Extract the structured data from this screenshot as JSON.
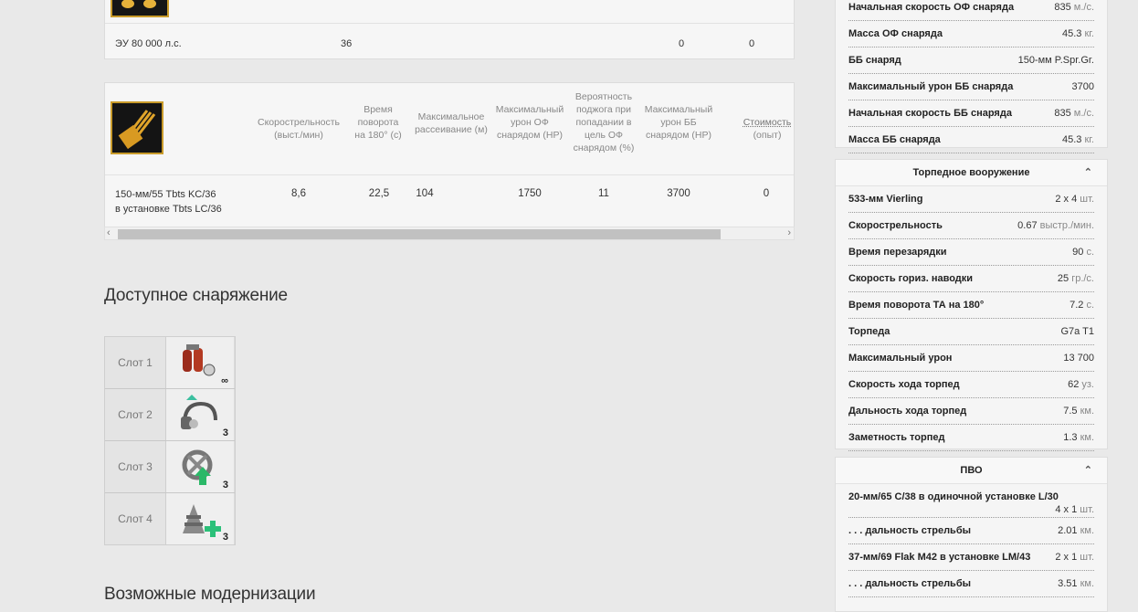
{
  "engine": {
    "name": "ЭУ 80 000 л.с.",
    "speed": "36",
    "c1": "0",
    "c2": "0"
  },
  "guns": {
    "headers": [
      "Скорострельность (выст./мин)",
      "Время поворота на 180° (с)",
      "Максимальное рассеивание (м)",
      "Максимальный урон ОФ снарядом (HP)",
      "Вероятность поджога при попадании в цель ОФ снарядом (%)",
      "Максимальный урон ББ снарядом (HP)",
      "Стоимость",
      "(опыт)"
    ],
    "row": {
      "name_line1": "150-мм/55 Tbts KC/36",
      "name_line2": "в установке Tbts LC/36",
      "values": [
        "8,6",
        "22,5",
        "104",
        "1750",
        "11",
        "3700",
        "0"
      ]
    }
  },
  "equipment": {
    "title": "Доступное снаряжение",
    "slots": [
      {
        "label": "Слот 1",
        "count": "∞",
        "icon": "damage-control-icon"
      },
      {
        "label": "Слот 2",
        "count": "3",
        "icon": "hydroacoustic-search-icon"
      },
      {
        "label": "Слот 3",
        "count": "3",
        "icon": "engine-boost-icon"
      },
      {
        "label": "Слот 4",
        "count": "3",
        "icon": "repair-party-icon"
      }
    ]
  },
  "upgrades": {
    "title": "Возможные модернизации"
  },
  "sidebar": {
    "main_battery_tail": [
      {
        "k": "Начальная скорость ОФ снаряда",
        "v": "835",
        "u": "м./с."
      },
      {
        "k": "Масса ОФ снаряда",
        "v": "45.3",
        "u": "кг."
      },
      {
        "k": "ББ снаряд",
        "v": "150-мм P.Spr.Gr.",
        "u": ""
      },
      {
        "k": "Максимальный урон ББ снаряда",
        "v": "3700",
        "u": ""
      },
      {
        "k": "Начальная скорость ББ снаряда",
        "v": "835",
        "u": "м./с."
      },
      {
        "k": "Масса ББ снаряда",
        "v": "45.3",
        "u": "кг."
      }
    ],
    "torpedo": {
      "title": "Торпедное вооружение",
      "rows": [
        {
          "k": "533-мм Vierling",
          "v": "2 x 4",
          "u": "шт."
        },
        {
          "k": "Скорострельность",
          "v": "0.67",
          "u": "выстр./мин."
        },
        {
          "k": "Время перезарядки",
          "v": "90",
          "u": "с."
        },
        {
          "k": "Скорость гориз. наводки",
          "v": "25",
          "u": "гр./с."
        },
        {
          "k": "Время поворота ТА на 180°",
          "v": "7.2",
          "u": "с."
        },
        {
          "k": "Торпеда",
          "v": "G7a T1",
          "u": ""
        },
        {
          "k": "Максимальный урон",
          "v": "13 700",
          "u": ""
        },
        {
          "k": "Скорость хода торпед",
          "v": "62",
          "u": "уз."
        },
        {
          "k": "Дальность хода торпед",
          "v": "7.5",
          "u": "км."
        },
        {
          "k": "Заметность торпед",
          "v": "1.3",
          "u": "км."
        }
      ]
    },
    "aa": {
      "title": "ПВО",
      "rows": [
        {
          "k": "20-мм/65 C/38 в одиночной установке L/30",
          "v": "4 x 1",
          "u": "шт."
        },
        {
          "k": ". . . дальность стрельбы",
          "v": "2.01",
          "u": "км."
        },
        {
          "k": "37-мм/69 Flak M42 в установке LM/43",
          "v": "2 x 1",
          "u": "шт."
        },
        {
          "k": ". . . дальность стрельбы",
          "v": "3.51",
          "u": "км."
        }
      ]
    }
  }
}
